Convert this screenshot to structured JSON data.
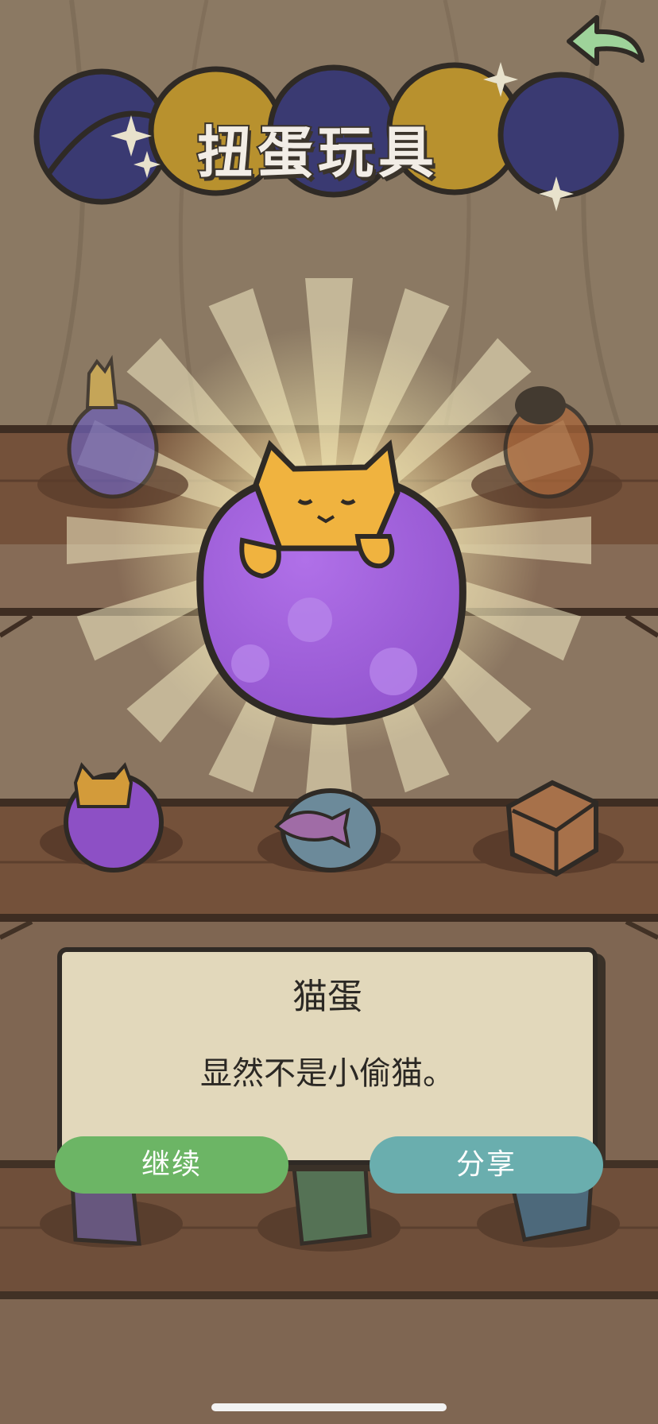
{
  "header": {
    "title": "扭蛋玩具"
  },
  "dialog": {
    "title": "猫蛋",
    "text": "显然不是小偷猫。",
    "continue_label": "继续",
    "share_label": "分享"
  },
  "icons": {
    "back": "back-arrow-icon",
    "sparkle": "sparkle-icon"
  },
  "colors": {
    "continue_button": "#6cb565",
    "share_button": "#6aaeae",
    "dialog_bg": "#e2d8bb",
    "featured_egg": "#9f5fd6"
  }
}
